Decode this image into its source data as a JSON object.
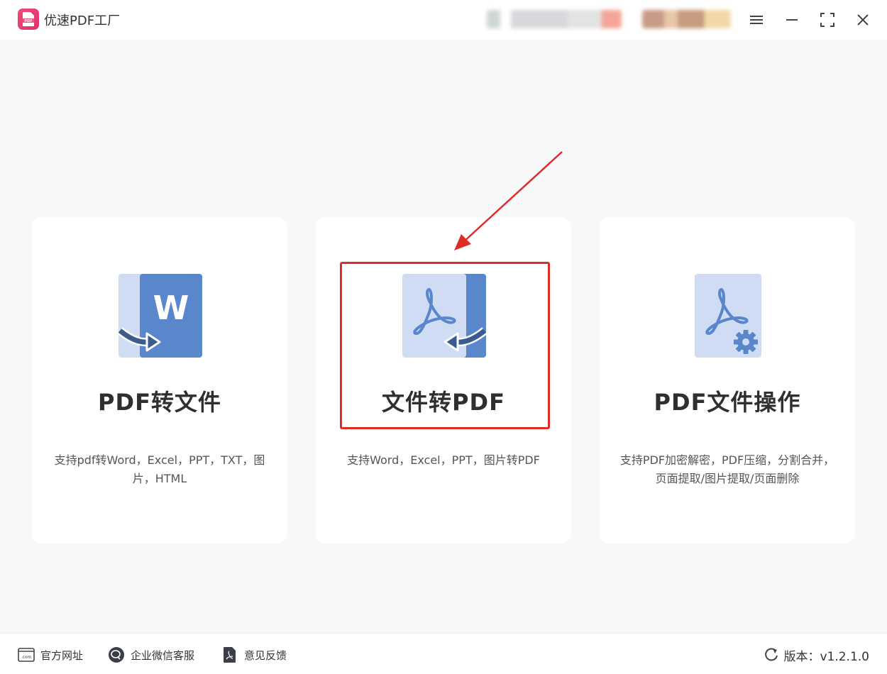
{
  "app": {
    "title": "优速PDF工厂",
    "logo_text": "PDF"
  },
  "window_controls": {
    "menu_icon": "hamburger-menu-icon",
    "minimize_icon": "minimize-icon",
    "maximize_icon": "maximize-icon",
    "close_icon": "close-icon"
  },
  "cards": [
    {
      "title": "PDF转文件",
      "description": "支持pdf转Word，Excel，PPT，TXT，图片，HTML",
      "icon": "pdf-to-word-icon",
      "icon_letter": "W"
    },
    {
      "title": "文件转PDF",
      "description": "支持Word，Excel，PPT，图片转PDF",
      "icon": "file-to-pdf-icon"
    },
    {
      "title": "PDF文件操作",
      "description": "支持PDF加密解密，PDF压缩，分割合并，页面提取/图片提取/页面删除",
      "icon": "pdf-operations-icon"
    }
  ],
  "footer": {
    "links": [
      {
        "label": "官方网址",
        "icon": "website-icon",
        "icon_text": ".com"
      },
      {
        "label": "企业微信客服",
        "icon": "wechat-service-icon"
      },
      {
        "label": "意见反馈",
        "icon": "feedback-icon"
      }
    ],
    "version": "版本：v1.2.1.0"
  },
  "colors": {
    "accent_blue": "#5a86cc",
    "light_blue": "#cfdcf3",
    "dark_arrow": "#3b5a8e",
    "annotation_red": "#e02b26",
    "logo_pink": "#e8386e"
  }
}
